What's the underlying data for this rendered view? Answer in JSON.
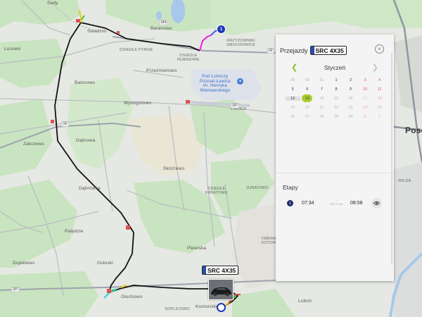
{
  "map": {
    "labels": {
      "sady": "Sady",
      "swadzim": "Swadzim",
      "baranowo": "Baranowo",
      "krzyzowniki": "KRZYŻOWNIKI\nSMOCHOWICE",
      "lusowo": "Lusowo",
      "osiedle_ptasie": "OSIEDLE PTASIE",
      "osiedle_rubinowe": "OSIEDLE\nRUBINOWE",
      "przezmierowo": "Przeźmierowo",
      "batorowo": "Batorowo",
      "airport": "Port Lotniczy\nPoznań-Ławica\nim. Henryka\nWieniawskiego",
      "wysogotowo": "Wysogotowo",
      "lawica": "ŁAWICA",
      "zakrzewo": "Zakrzewo",
      "dabrowa": "Dąbrowa",
      "skorzewo": "Skórzewo",
      "osiedle_kwiatowe": "OSIEDLE\nKWIATOWE",
      "junikowo": "JUNIKOWO",
      "dabrowka": "Dąbrówka",
      "poznan": "Pose",
      "wilda": "WILDA",
      "paledzie": "Palędzie",
      "plewiska": "Plewiska",
      "dopiewiec": "Dopiewiec",
      "golusk": "Gołuski",
      "gluchowo": "Głuchowo",
      "komorniki": "Komorniki",
      "sopliciowo": "SOPLICOWO",
      "lubon": "Luboń",
      "fabianowo": "FABIANOWO\nKOTOWO"
    },
    "road_numbers": {
      "r184": "184",
      "r92a": "92",
      "r307a": "307",
      "r307b": "307",
      "r92b": "92"
    },
    "vehicle_plate": "SRC 4X35",
    "waypoint_number": "1"
  },
  "panel": {
    "title": "Przejazdy",
    "plate": "SRC 4X35",
    "close_icon": "close-icon",
    "month": "Styczeń",
    "prev_icon": "chevron-left-icon",
    "next_icon": "chevron-right-icon",
    "calendar": [
      [
        {
          "d": "29",
          "s": "dim"
        },
        {
          "d": "30",
          "s": "dim"
        },
        {
          "d": "31",
          "s": "dim"
        },
        {
          "d": "1",
          "s": ""
        },
        {
          "d": "2",
          "s": ""
        },
        {
          "d": "3",
          "s": "red"
        },
        {
          "d": "4",
          "s": "red"
        }
      ],
      [
        {
          "d": "5",
          "s": ""
        },
        {
          "d": "6",
          "s": ""
        },
        {
          "d": "7",
          "s": ""
        },
        {
          "d": "8",
          "s": ""
        },
        {
          "d": "9",
          "s": ""
        },
        {
          "d": "10",
          "s": "red"
        },
        {
          "d": "11",
          "s": "red"
        }
      ],
      [
        {
          "d": "12",
          "s": "range"
        },
        {
          "d": "13",
          "s": "sel"
        },
        {
          "d": "14",
          "s": "dim"
        },
        {
          "d": "15",
          "s": "dim"
        },
        {
          "d": "16",
          "s": "dim"
        },
        {
          "d": "17",
          "s": "redDim"
        },
        {
          "d": "18",
          "s": "redDim"
        }
      ],
      [
        {
          "d": "19",
          "s": "dim"
        },
        {
          "d": "20",
          "s": "dim"
        },
        {
          "d": "21",
          "s": "dim"
        },
        {
          "d": "22",
          "s": "dim"
        },
        {
          "d": "23",
          "s": "dim"
        },
        {
          "d": "24",
          "s": "redDim"
        },
        {
          "d": "25",
          "s": "redDim"
        }
      ],
      [
        {
          "d": "26",
          "s": "dim"
        },
        {
          "d": "27",
          "s": "dim"
        },
        {
          "d": "28",
          "s": "dim"
        },
        {
          "d": "29",
          "s": "dim"
        },
        {
          "d": "30",
          "s": "dim"
        },
        {
          "d": "31",
          "s": "redDim"
        },
        {
          "d": "1",
          "s": "redDim"
        }
      ]
    ],
    "stages_title": "Etapy",
    "stages": [
      {
        "num": "1",
        "start": "07:34",
        "distance": "120,77 km",
        "end": "08:58",
        "eye_icon": "eye-icon"
      }
    ]
  },
  "colors": {
    "route": "#111111",
    "accent": "#a6cf2d",
    "marker": "#1d37b8"
  }
}
